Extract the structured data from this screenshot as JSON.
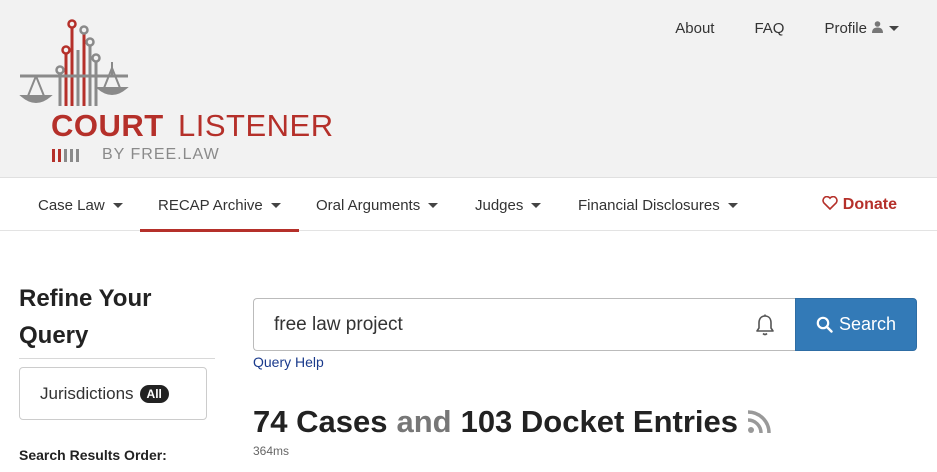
{
  "brand": {
    "name_bold": "COURT",
    "name_light": "LISTENER",
    "byline": "BY FREE.LAW",
    "colors": {
      "primary": "#b5302a",
      "gray": "#8a8a8a"
    }
  },
  "top_nav": {
    "about": "About",
    "faq": "FAQ",
    "profile": "Profile",
    "profile_icon": "person-icon"
  },
  "main_nav": {
    "items": [
      {
        "label": "Case Law",
        "active": false
      },
      {
        "label": "RECAP Archive",
        "active": true
      },
      {
        "label": "Oral Arguments",
        "active": false
      },
      {
        "label": "Judges",
        "active": false
      },
      {
        "label": "Financial Disclosures",
        "active": false
      }
    ],
    "donate": "Donate",
    "donate_icon": "heart-icon"
  },
  "sidebar": {
    "title": "Refine Your Query",
    "jurisdictions_label": "Jurisdictions",
    "jurisdictions_badge": "All",
    "order_label": "Search Results Order:"
  },
  "search": {
    "value": "free law project",
    "button_label": "Search",
    "query_help": "Query Help",
    "accent_color": "#337ab7"
  },
  "results": {
    "cases": "74 Cases",
    "and": "and",
    "entries": "103 Docket Entries",
    "timing": "364ms"
  }
}
